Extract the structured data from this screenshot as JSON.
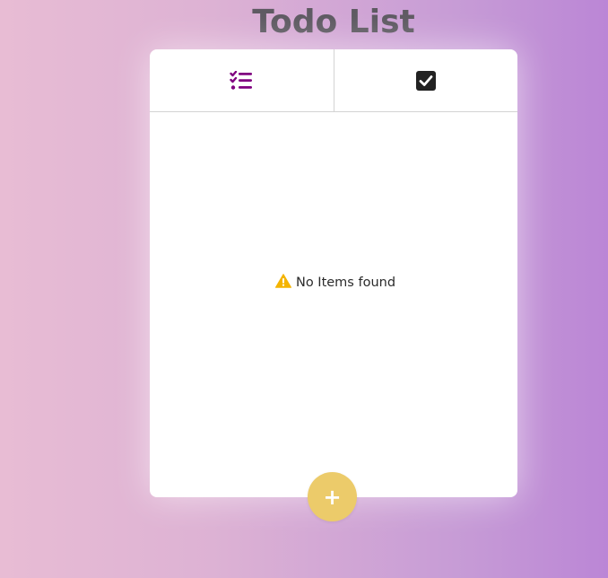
{
  "app": {
    "title": "Todo List"
  },
  "tabs": [
    {
      "icon": "list-check-icon",
      "color": "#800080",
      "active": true
    },
    {
      "icon": "checked-square-icon",
      "color": "#222222",
      "active": false
    }
  ],
  "empty_state": {
    "icon": "warning-icon",
    "icon_color": "#f4b400",
    "message": "No Items found"
  },
  "fab": {
    "label": "+",
    "color": "#eccb6a"
  }
}
